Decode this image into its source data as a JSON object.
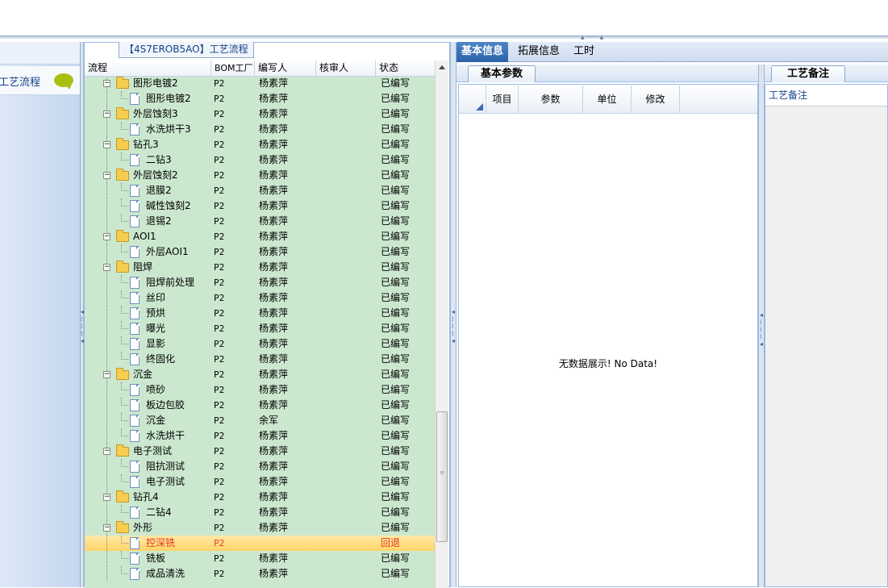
{
  "left_panel": {
    "item_label": "工艺流程"
  },
  "tree_panel": {
    "title": "【4S7EROB5AO】工艺流程",
    "columns": {
      "name": "流程",
      "bom": "BOM工厂",
      "writer": "编写人",
      "reviewer": "核审人",
      "status": "状态"
    }
  },
  "rows": [
    {
      "name": "图形电镀2",
      "bom": "P2",
      "writer": "杨素萍",
      "status": "已编写"
    },
    {
      "name": "图形电镀2",
      "bom": "P2",
      "writer": "杨素萍",
      "status": "已编写"
    },
    {
      "name": "外层蚀刻3",
      "bom": "P2",
      "writer": "杨素萍",
      "status": "已编写"
    },
    {
      "name": "水洗烘干3",
      "bom": "P2",
      "writer": "杨素萍",
      "status": "已编写"
    },
    {
      "name": "钻孔3",
      "bom": "P2",
      "writer": "杨素萍",
      "status": "已编写"
    },
    {
      "name": "二钻3",
      "bom": "P2",
      "writer": "杨素萍",
      "status": "已编写"
    },
    {
      "name": "外层蚀刻2",
      "bom": "P2",
      "writer": "杨素萍",
      "status": "已编写"
    },
    {
      "name": "退膜2",
      "bom": "P2",
      "writer": "杨素萍",
      "status": "已编写"
    },
    {
      "name": "碱性蚀刻2",
      "bom": "P2",
      "writer": "杨素萍",
      "status": "已编写"
    },
    {
      "name": "退锡2",
      "bom": "P2",
      "writer": "杨素萍",
      "status": "已编写"
    },
    {
      "name": "AOI1",
      "bom": "P2",
      "writer": "杨素萍",
      "status": "已编写"
    },
    {
      "name": "外层AOI1",
      "bom": "P2",
      "writer": "杨素萍",
      "status": "已编写"
    },
    {
      "name": "阻焊",
      "bom": "P2",
      "writer": "杨素萍",
      "status": "已编写"
    },
    {
      "name": "阻焊前处理",
      "bom": "P2",
      "writer": "杨素萍",
      "status": "已编写"
    },
    {
      "name": "丝印",
      "bom": "P2",
      "writer": "杨素萍",
      "status": "已编写"
    },
    {
      "name": "预烘",
      "bom": "P2",
      "writer": "杨素萍",
      "status": "已编写"
    },
    {
      "name": "曝光",
      "bom": "P2",
      "writer": "杨素萍",
      "status": "已编写"
    },
    {
      "name": "显影",
      "bom": "P2",
      "writer": "杨素萍",
      "status": "已编写"
    },
    {
      "name": "终固化",
      "bom": "P2",
      "writer": "杨素萍",
      "status": "已编写"
    },
    {
      "name": "沉金",
      "bom": "P2",
      "writer": "杨素萍",
      "status": "已编写"
    },
    {
      "name": "喷砂",
      "bom": "P2",
      "writer": "杨素萍",
      "status": "已编写"
    },
    {
      "name": "板边包胶",
      "bom": "P2",
      "writer": "杨素萍",
      "status": "已编写"
    },
    {
      "name": "沉金",
      "bom": "P2",
      "writer": "余军",
      "status": "已编写"
    },
    {
      "name": "水洗烘干",
      "bom": "P2",
      "writer": "杨素萍",
      "status": "已编写"
    },
    {
      "name": "电子测试",
      "bom": "P2",
      "writer": "杨素萍",
      "status": "已编写"
    },
    {
      "name": "阻抗测试",
      "bom": "P2",
      "writer": "杨素萍",
      "status": "已编写"
    },
    {
      "name": "电子测试",
      "bom": "P2",
      "writer": "杨素萍",
      "status": "已编写"
    },
    {
      "name": "钻孔4",
      "bom": "P2",
      "writer": "杨素萍",
      "status": "已编写"
    },
    {
      "name": "二钻4",
      "bom": "P2",
      "writer": "杨素萍",
      "status": "已编写"
    },
    {
      "name": "外形",
      "bom": "P2",
      "writer": "杨素萍",
      "status": "已编写"
    },
    {
      "name": "控深铣",
      "bom": "P2",
      "writer": "",
      "status": "回退"
    },
    {
      "name": "铣板",
      "bom": "P2",
      "writer": "杨素萍",
      "status": "已编写"
    },
    {
      "name": "成品清洗",
      "bom": "P2",
      "writer": "杨素萍",
      "status": "已编写"
    }
  ],
  "right": {
    "tabs": [
      "基本信息",
      "拓展信息",
      "工时"
    ],
    "subtab": "基本参数",
    "grid_columns": [
      "项目",
      "参数",
      "单位",
      "修改"
    ],
    "empty_text": "无数据展示! No Data!",
    "note_tab": "工艺备注",
    "note_header": "工艺备注"
  }
}
